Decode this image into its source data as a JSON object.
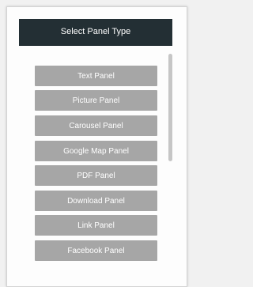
{
  "dialog": {
    "title": "Select Panel Type"
  },
  "panel_types": [
    {
      "label": "Text Panel"
    },
    {
      "label": "Picture Panel"
    },
    {
      "label": "Carousel Panel"
    },
    {
      "label": "Google Map Panel"
    },
    {
      "label": "PDF Panel"
    },
    {
      "label": "Download Panel"
    },
    {
      "label": "Link Panel"
    },
    {
      "label": "Facebook Panel"
    }
  ],
  "colors": {
    "header_bg": "#232f34",
    "button_bg": "#a6a6a6",
    "button_text": "#ffffff"
  }
}
